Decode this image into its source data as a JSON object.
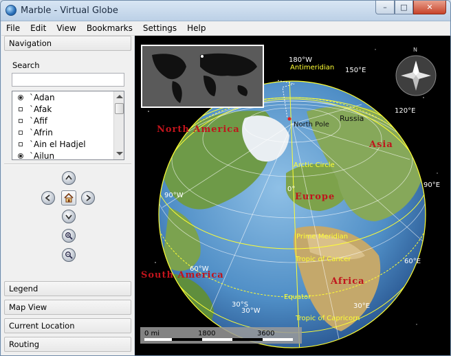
{
  "window": {
    "title": "Marble - Virtual Globe"
  },
  "titlebar_buttons": {
    "minimize": "–",
    "maximize": "□",
    "close": "✕"
  },
  "menu": [
    "File",
    "Edit",
    "View",
    "Bookmarks",
    "Settings",
    "Help"
  ],
  "sidebar": {
    "navigation_header": "Navigation",
    "search_label": "Search",
    "search_value": "",
    "list_items": [
      {
        "label": "`Adan",
        "marker": "circle"
      },
      {
        "label": "`Afak",
        "marker": "square"
      },
      {
        "label": "`Afif",
        "marker": "square"
      },
      {
        "label": "`Afrin",
        "marker": "square"
      },
      {
        "label": "`Ain el Hadjel",
        "marker": "square"
      },
      {
        "label": "`Ailun",
        "marker": "circle"
      }
    ],
    "nav_icons": [
      "arrow-up-icon",
      "arrow-left-icon",
      "home-icon",
      "arrow-right-icon",
      "arrow-down-icon",
      "zoom-in-icon",
      "zoom-out-icon"
    ],
    "sections": [
      "Legend",
      "Map View",
      "Current Location",
      "Routing"
    ]
  },
  "map": {
    "continents": [
      "North America",
      "South America",
      "Europe",
      "Asia",
      "Africa"
    ],
    "places": [
      "Russia",
      "North Pole"
    ],
    "lines": [
      "Antimeridian",
      "Arctic Circle",
      "Prime Meridian",
      "Tropic of Cancer",
      "Equator",
      "Tropic of Capricorn"
    ],
    "coords": [
      "180°W",
      "150°E",
      "120°E",
      "90°E",
      "60°E",
      "30°E",
      "90°W",
      "60°W",
      "30°S",
      "30°W",
      "0°"
    ],
    "scale": {
      "unit": "0 mi",
      "mid": "1800",
      "max": "3600"
    },
    "compass_letter": "N"
  },
  "colors": {
    "continent_label": "#c0141c",
    "line_label": "#ffff33",
    "coord_label": "#ffffff",
    "ocean": "#5a97c9",
    "land": "#6f9a4a"
  }
}
